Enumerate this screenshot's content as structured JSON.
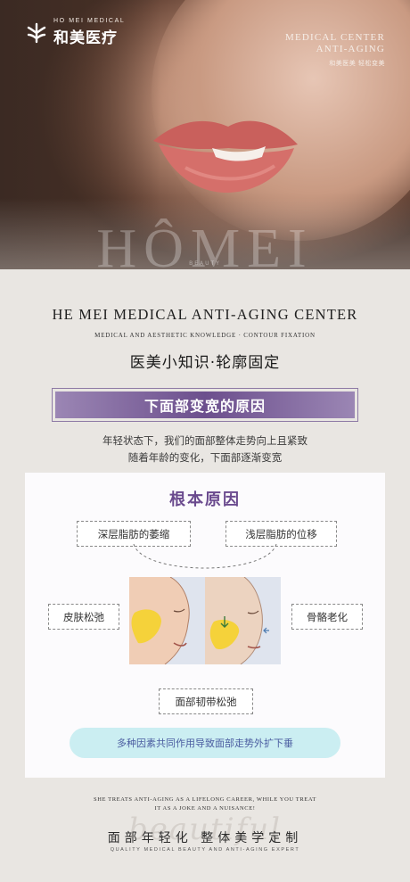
{
  "brand": {
    "en": "HO MEI MEDICAL",
    "cn": "和美医疗",
    "tag_line1": "MEDICAL CENTER",
    "tag_line2": "ANTI-AGING",
    "tag_line3": "和美医美 轻松变美"
  },
  "hero": {
    "watermark": "HÔMEI",
    "watermark_sub": "BEAUTY"
  },
  "heading": {
    "en": "HE MEI MEDICAL ANTI-AGING CENTER",
    "en_sub": "MEDICAL AND AESTHETIC KNOWLEDGE  ·  CONTOUR FIXATION",
    "cn": "医美小知识·轮廓固定"
  },
  "banner": {
    "label": "下面部变宽的原因"
  },
  "intro": {
    "line1": "年轻状态下，我们的面部整体走势向上且紧致",
    "line2": "随着年龄的变化，下面部逐渐变宽"
  },
  "card": {
    "title": "根本原因",
    "cause_deep_fat": "深层脂肪的萎缩",
    "cause_shallow_fat": "浅层脂肪的位移",
    "cause_skin": "皮肤松弛",
    "cause_bone": "骨骼老化",
    "cause_ligament": "面部韧带松弛",
    "summary": "多种因素共同作用导致面部走势外扩下垂"
  },
  "footer": {
    "en_line1": "SHE TREATS ANTI-AGING AS A LIFELONG CAREER, WHILE YOU TREAT",
    "en_line2": "IT AS A JOKE AND A NUISANCE!",
    "script": "beautiful",
    "cn": "面部年轻化  整体美学定制",
    "sub": "QUALITY MEDICAL BEAUTY AND ANTI-AGING EXPERT"
  },
  "colors": {
    "accent_purple": "#6a4a8e",
    "pill_bg": "#cbeef2",
    "background": "#e9e6e2"
  }
}
